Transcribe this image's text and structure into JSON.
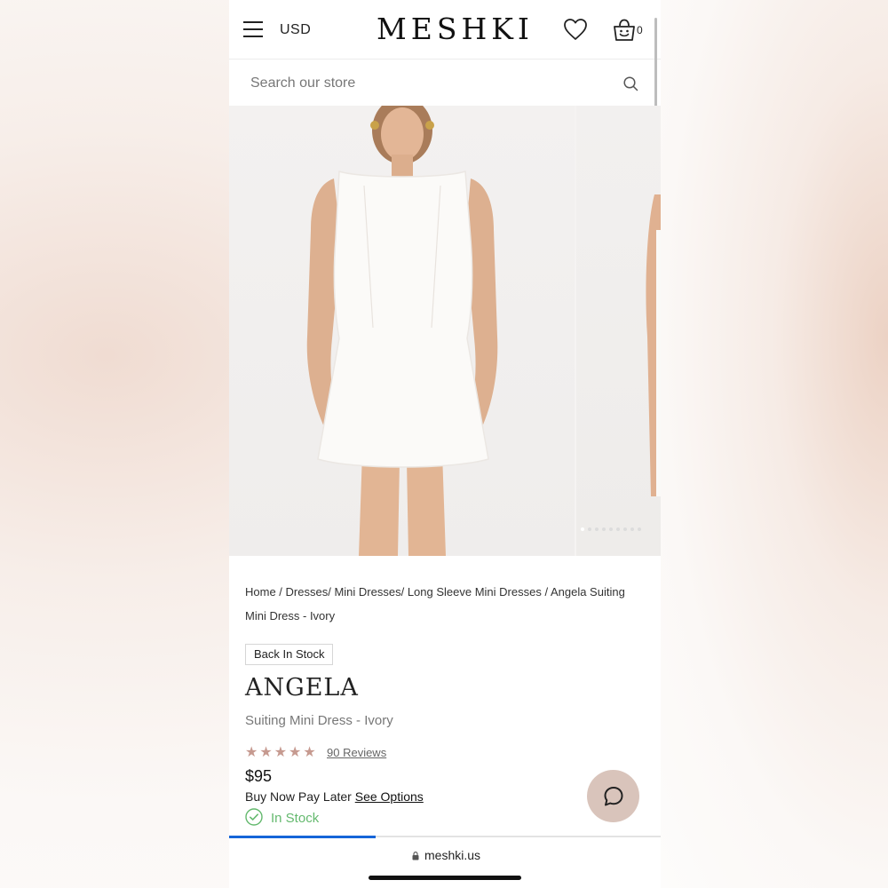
{
  "header": {
    "currency": "USD",
    "brand": "MESHKI",
    "cart_count": "0",
    "icons": [
      "menu-icon",
      "heart-icon",
      "bag-icon"
    ]
  },
  "search": {
    "placeholder": "Search our store",
    "icon": "search-icon"
  },
  "gallery": {
    "slides_total": 9,
    "active_slide": 1
  },
  "breadcrumb": {
    "items": [
      "Home",
      "Dresses",
      "Mini Dresses",
      "Long Sleeve Mini Dresses",
      "Angela Suiting Mini Dress - Ivory"
    ]
  },
  "product": {
    "badge": "Back In Stock",
    "name": "ANGELA",
    "subtitle": "Suiting Mini Dress - Ivory",
    "rating_stars": 5,
    "reviews": "90 Reviews",
    "price": "$95",
    "bnpl_text": "Buy Now Pay Later",
    "bnpl_link": "See Options",
    "stock": "In Stock"
  },
  "browser": {
    "url": "meshki.us",
    "load_progress": 0.34
  },
  "colors": {
    "stars": "#c69a90",
    "in_stock": "#64b96e",
    "chat_bg": "#d9c4bb",
    "progress": "#1565d8"
  }
}
